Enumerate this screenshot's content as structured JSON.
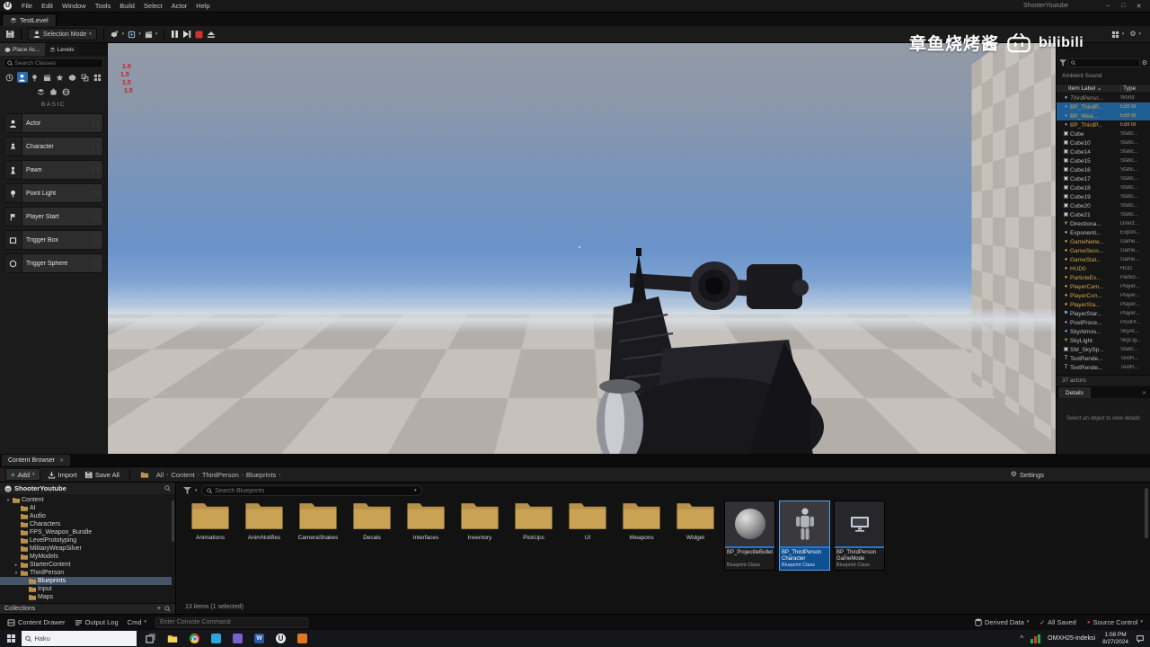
{
  "icons": {
    "caret_down": "▾",
    "caret_right": "▸",
    "sort_asc": "▲",
    "close": "✕",
    "minimize": "–",
    "maximize": "□",
    "check": "✓",
    "dot": "●",
    "grip": "⋮⋮",
    "plus": "+",
    "gear": "⚙",
    "breadcrumb_sep": "›",
    "hidden_items": "^",
    "ue_letter": "U",
    "word_letter": "W"
  },
  "colors": {
    "selection_blue": "#1f5e93",
    "runtime_gold": "#cfa54b",
    "stop_red": "#cf352c",
    "blueprint_bar": "#1d7ad6",
    "folder_tan": "#c49a4e"
  },
  "menu": {
    "items": [
      "File",
      "Edit",
      "Window",
      "Tools",
      "Build",
      "Select",
      "Actor",
      "Help"
    ],
    "app_title": "ShooterYoutube"
  },
  "level_tab": {
    "label": "TestLevel"
  },
  "toolbar": {
    "mode_label": "Selection Mode"
  },
  "watermark": {
    "text": "章鱼烧烤酱",
    "brand": "bilibili"
  },
  "place_panel": {
    "tab_place": "Place Ac...",
    "tab_levels": "Levels",
    "search_placeholder": "Search Classes",
    "category": "BASIC",
    "items": [
      {
        "label": "Actor"
      },
      {
        "label": "Character"
      },
      {
        "label": "Pawn"
      },
      {
        "label": "Point Light"
      },
      {
        "label": "Player Start"
      },
      {
        "label": "Trigger Box"
      },
      {
        "label": "Trigger Sphere"
      }
    ]
  },
  "viewport": {
    "debug_lines": [
      "1.5",
      "1.5",
      "1.5",
      "1.5"
    ]
  },
  "outliner": {
    "ghost": "Ambient Sound",
    "header_label": "Item Label",
    "header_type": "Type",
    "footer": "37 actors",
    "rows": [
      {
        "label": "ThirdPerso...",
        "type": "World",
        "glyph": "●",
        "glyph_color": "#7fa8d0",
        "dim": true
      },
      {
        "label": "BP_ThirdP...",
        "type": "Edit Bl",
        "glyph": "●",
        "glyph_color": "#5a8fd6",
        "selected": true,
        "gold": true,
        "link": true
      },
      {
        "label": "BP_Wea...",
        "type": "Edit Bl",
        "glyph": "●",
        "glyph_color": "#5a8fd6",
        "selected": true,
        "gold": true,
        "link": true
      },
      {
        "label": "BP_ThirdP...",
        "type": "Edit Bl",
        "glyph": "●",
        "glyph_color": "#5a8fd6",
        "gold": true,
        "link": true
      },
      {
        "label": "Cube",
        "type": "Static...",
        "glyph": "▣",
        "glyph_color": "#c9c9c9"
      },
      {
        "label": "Cube10",
        "type": "Static...",
        "glyph": "▣",
        "glyph_color": "#c9c9c9"
      },
      {
        "label": "Cube14",
        "type": "Static...",
        "glyph": "▣",
        "glyph_color": "#c9c9c9"
      },
      {
        "label": "Cube15",
        "type": "Static...",
        "glyph": "▣",
        "glyph_color": "#c9c9c9"
      },
      {
        "label": "Cube16",
        "type": "Static...",
        "glyph": "▣",
        "glyph_color": "#c9c9c9"
      },
      {
        "label": "Cube17",
        "type": "Static...",
        "glyph": "▣",
        "glyph_color": "#c9c9c9"
      },
      {
        "label": "Cube18",
        "type": "Static...",
        "glyph": "▣",
        "glyph_color": "#c9c9c9"
      },
      {
        "label": "Cube19",
        "type": "Static...",
        "glyph": "▣",
        "glyph_color": "#c9c9c9"
      },
      {
        "label": "Cube20",
        "type": "Static...",
        "glyph": "▣",
        "glyph_color": "#c9c9c9"
      },
      {
        "label": "Cube21",
        "type": "Static...",
        "glyph": "▣",
        "glyph_color": "#c9c9c9"
      },
      {
        "label": "Directiona...",
        "type": "Direct...",
        "glyph": "☀",
        "glyph_color": "#e2bf3a"
      },
      {
        "label": "Exponenti...",
        "type": "Expon...",
        "glyph": "●",
        "glyph_color": "#9fb3c4"
      },
      {
        "label": "GameNetw...",
        "type": "Game...",
        "glyph": "●",
        "glyph_color": "#c9a24a",
        "gold": true
      },
      {
        "label": "GameSess...",
        "type": "Game...",
        "glyph": "●",
        "glyph_color": "#c9a24a",
        "gold": true
      },
      {
        "label": "GameStat...",
        "type": "Game...",
        "glyph": "●",
        "glyph_color": "#c9a24a",
        "gold": true
      },
      {
        "label": "HUD0",
        "type": "HUD",
        "glyph": "●",
        "glyph_color": "#c9a24a",
        "gold": true
      },
      {
        "label": "ParticleEv...",
        "type": "Particl...",
        "glyph": "●",
        "glyph_color": "#c9a24a",
        "gold": true
      },
      {
        "label": "PlayerCam...",
        "type": "Player...",
        "glyph": "●",
        "glyph_color": "#c9a24a",
        "gold": true
      },
      {
        "label": "PlayerCon...",
        "type": "Player...",
        "glyph": "●",
        "glyph_color": "#c9a24a",
        "gold": true
      },
      {
        "label": "PlayerSta...",
        "type": "Player...",
        "glyph": "●",
        "glyph_color": "#c9a24a",
        "gold": true
      },
      {
        "label": "PlayerStar...",
        "type": "Player...",
        "glyph": "⚑",
        "glyph_color": "#6fb7e0"
      },
      {
        "label": "PostProce...",
        "type": "PostPr...",
        "glyph": "●",
        "glyph_color": "#b085c9"
      },
      {
        "label": "SkyAtmos...",
        "type": "SkyAt...",
        "glyph": "●",
        "glyph_color": "#6fa8dc"
      },
      {
        "label": "SkyLight",
        "type": "SkyLig...",
        "glyph": "☀",
        "glyph_color": "#e2bf3a"
      },
      {
        "label": "SM_SkySp...",
        "type": "Static...",
        "glyph": "▣",
        "glyph_color": "#c9c9c9"
      },
      {
        "label": "TextRende...",
        "type": "TextR...",
        "glyph": "T",
        "glyph_color": "#d0d0d0"
      },
      {
        "label": "TextRende...",
        "type": "TextR...",
        "glyph": "T",
        "glyph_color": "#d0d0d0"
      }
    ]
  },
  "details": {
    "tab": "Details",
    "empty": "Select an object to view details"
  },
  "content_browser": {
    "tab": "Content Browser",
    "add": "Add",
    "import": "Import",
    "save_all": "Save All",
    "settings": "Settings",
    "breadcrumbs": [
      {
        "label": "All"
      },
      {
        "label": "Content"
      },
      {
        "label": "ThirdPerson"
      },
      {
        "label": "Blueprints"
      }
    ],
    "search_placeholder": "Search Blueprints",
    "root": "ShooterYoutube",
    "tree": [
      {
        "label": "Content",
        "depth": 0,
        "caret": "▾"
      },
      {
        "label": "AI",
        "depth": 1,
        "caret": ""
      },
      {
        "label": "Audio",
        "depth": 1,
        "caret": ""
      },
      {
        "label": "Characters",
        "depth": 1,
        "caret": ""
      },
      {
        "label": "FPS_Weapon_Bundle",
        "depth": 1,
        "caret": ""
      },
      {
        "label": "LevelPrototyping",
        "depth": 1,
        "caret": ""
      },
      {
        "label": "MilitaryWeapSilver",
        "depth": 1,
        "caret": ""
      },
      {
        "label": "MyModels",
        "depth": 1,
        "caret": ""
      },
      {
        "label": "StarterContent",
        "depth": 1,
        "caret": "▸"
      },
      {
        "label": "ThirdPerson",
        "depth": 1,
        "caret": "▾"
      },
      {
        "label": "Blueprints",
        "depth": 2,
        "caret": "",
        "selected": true
      },
      {
        "label": "Input",
        "depth": 2,
        "caret": ""
      },
      {
        "label": "Maps",
        "depth": 2,
        "caret": ""
      }
    ],
    "collections": "Collections",
    "folders": [
      "Animations",
      "AnimNotifies",
      "CameraShakes",
      "Decals",
      "Interfaces",
      "Inventory",
      "PickUps",
      "UI",
      "Weapons",
      "Widget"
    ],
    "assets": [
      {
        "name": "BP_ProjectileBullet",
        "type": "Blueprint Class"
      },
      {
        "name": "BP_ThirdPerson Character",
        "type": "Blueprint Class",
        "selected": true
      },
      {
        "name": "BP_ThirdPerson GameMode",
        "type": "Blueprint Class"
      }
    ],
    "footer": "13 items (1 selected)"
  },
  "status_bar": {
    "content_drawer": "Content Drawer",
    "output_log": "Output Log",
    "cmd": "Cmd",
    "console_placeholder": "Enter Console Command",
    "derived_data": "Derived Data",
    "all_saved": "All Saved",
    "source_control": "Source Control"
  },
  "taskbar": {
    "search_placeholder": "Haku",
    "ticker": "OMXH25-indeksi",
    "time": "1:08 PM",
    "date": "8/27/2024"
  }
}
